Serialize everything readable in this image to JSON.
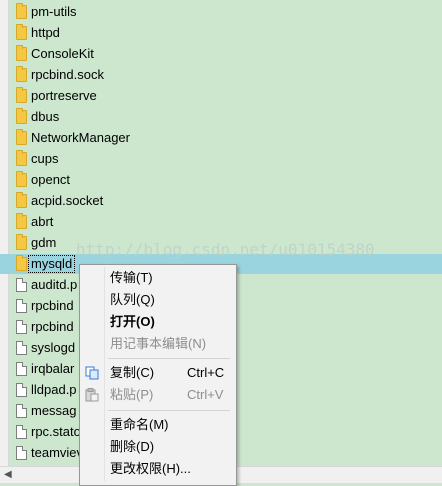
{
  "file_list": {
    "items": [
      {
        "name": "pm-utils",
        "type": "folder"
      },
      {
        "name": "httpd",
        "type": "folder"
      },
      {
        "name": "ConsoleKit",
        "type": "folder"
      },
      {
        "name": "rpcbind.sock",
        "type": "folder"
      },
      {
        "name": "portreserve",
        "type": "folder"
      },
      {
        "name": "dbus",
        "type": "folder"
      },
      {
        "name": "NetworkManager",
        "type": "folder"
      },
      {
        "name": "cups",
        "type": "folder"
      },
      {
        "name": "openct",
        "type": "folder"
      },
      {
        "name": "acpid.socket",
        "type": "folder"
      },
      {
        "name": "abrt",
        "type": "folder"
      },
      {
        "name": "gdm",
        "type": "folder"
      },
      {
        "name": "mysqld",
        "type": "folder",
        "selected": true
      },
      {
        "name": "auditd.p",
        "type": "file"
      },
      {
        "name": "rpcbind",
        "type": "file"
      },
      {
        "name": "rpcbind",
        "type": "file"
      },
      {
        "name": "syslogd",
        "type": "file"
      },
      {
        "name": "irqbalar",
        "type": "file"
      },
      {
        "name": "lldpad.p",
        "type": "file"
      },
      {
        "name": "messag",
        "type": "file"
      },
      {
        "name": "rpc.stato",
        "type": "file"
      },
      {
        "name": "teamviev",
        "type": "file"
      }
    ]
  },
  "watermark": "http://blog.csdn.net/u010154380",
  "context_menu": {
    "items": [
      {
        "label": "传输(T)",
        "shortcut": "",
        "state": "normal"
      },
      {
        "label": "队列(Q)",
        "shortcut": "",
        "state": "normal"
      },
      {
        "label": "打开(O)",
        "shortcut": "",
        "state": "bold"
      },
      {
        "label": "用记事本编辑(N)",
        "shortcut": "",
        "state": "disabled"
      },
      {
        "label": "复制(C)",
        "shortcut": "Ctrl+C",
        "state": "normal",
        "icon": "copy-icon"
      },
      {
        "label": "粘贴(P)",
        "shortcut": "Ctrl+V",
        "state": "disabled",
        "icon": "paste-icon"
      },
      {
        "label": "重命名(M)",
        "shortcut": "",
        "state": "normal"
      },
      {
        "label": "删除(D)",
        "shortcut": "",
        "state": "normal"
      },
      {
        "label": "更改权限(H)...",
        "shortcut": "",
        "state": "normal"
      }
    ]
  },
  "colors": {
    "pane_background": "#cde7cf",
    "selection": "#9ad4de",
    "folder": "#f5c844",
    "menu_background": "#f2f2f2"
  }
}
